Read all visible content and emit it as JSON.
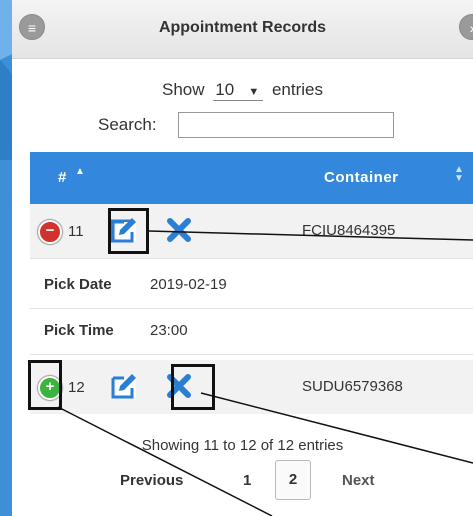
{
  "header": {
    "title": "Appointment Records",
    "left_icon": "menu-icon",
    "right_icon": "back-icon"
  },
  "controls": {
    "show_label": "Show",
    "entries_value": "10",
    "entries_label": "entries",
    "search_label": "Search:",
    "search_value": ""
  },
  "table": {
    "col_num": "#",
    "col_container": "Container",
    "rows": [
      {
        "num": "11",
        "container": "FCIU8464395",
        "expanded": true
      },
      {
        "num": "12",
        "container": "SUDU6579368",
        "expanded": false
      }
    ],
    "details": {
      "pick_date_label": "Pick Date",
      "pick_date": "2019-02-19",
      "pick_time_label": "Pick Time",
      "pick_time": "23:00"
    }
  },
  "footer": {
    "info": "Showing 11 to 12 of 12 entries",
    "previous": "Previous",
    "page1": "1",
    "page2": "2",
    "next": "Next"
  },
  "colors": {
    "header_bg": "#3388dd",
    "minus": "#d2322d",
    "plus": "#3cb33c",
    "icon_blue": "#2a7fd4"
  }
}
